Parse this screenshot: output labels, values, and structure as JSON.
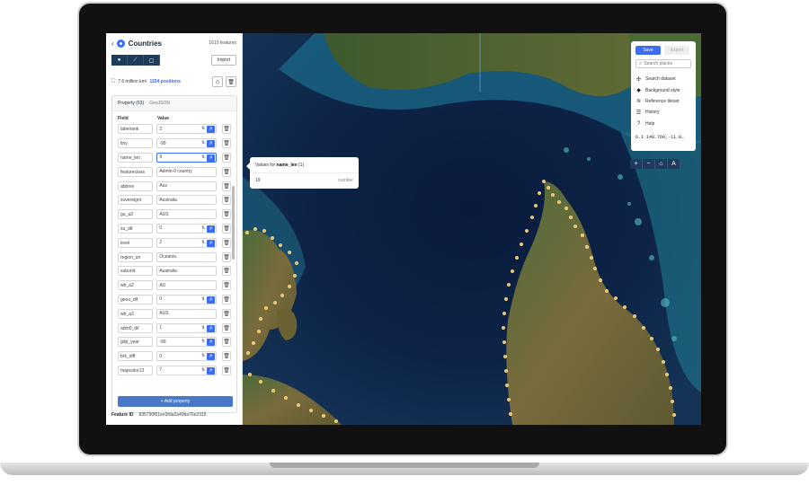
{
  "panel": {
    "title": "Countries",
    "feature_count": "1619 features",
    "import_label": "Import",
    "area": "7.6 million km²",
    "positions": "1154 positions",
    "tabs": [
      "Property (63)",
      "GeoJSON"
    ],
    "columns": {
      "field": "Field",
      "value": "Value"
    },
    "properties": [
      {
        "field": "labelrank",
        "value": "2",
        "numeric": true
      },
      {
        "field": "tiny",
        "value": "-99",
        "numeric": true
      },
      {
        "field": "name_len",
        "value": "9",
        "numeric": true,
        "focused": true
      },
      {
        "field": "featureclass",
        "value": "Admin-0 country",
        "numeric": false
      },
      {
        "field": "abbrev",
        "value": "Aus",
        "numeric": false
      },
      {
        "field": "sovereignt",
        "value": "Australia",
        "numeric": false
      },
      {
        "field": "gu_a3",
        "value": "AUS",
        "numeric": false
      },
      {
        "field": "su_dif",
        "value": "0",
        "numeric": true
      },
      {
        "field": "level",
        "value": "2",
        "numeric": true
      },
      {
        "field": "region_un",
        "value": "Oceania",
        "numeric": false
      },
      {
        "field": "subunit",
        "value": "Australia",
        "numeric": false
      },
      {
        "field": "wb_a2",
        "value": "AU",
        "numeric": false
      },
      {
        "field": "geou_dif",
        "value": "0",
        "numeric": true
      },
      {
        "field": "wb_a3",
        "value": "AUS",
        "numeric": false
      },
      {
        "field": "adm0_dif",
        "value": "1",
        "numeric": true
      },
      {
        "field": "gdp_year",
        "value": "-99",
        "numeric": true
      },
      {
        "field": "brk_diff",
        "value": "0",
        "numeric": true
      },
      {
        "field": "mapcolor13",
        "value": "7",
        "numeric": true
      }
    ],
    "add_property_label": "+ Add property",
    "feature_id_label": "Feature ID",
    "feature_id": "835790f61ee3fda2a40ba76e2915"
  },
  "tooltip": {
    "title_prefix": "Values for",
    "field": "name_len",
    "count": "(1)",
    "value": "19",
    "unit": "number"
  },
  "menu": {
    "save_label": "Save",
    "export_label": "Export",
    "search_placeholder": "Search places",
    "items": [
      {
        "label": "Search dataset",
        "icon": "search-dataset-icon"
      },
      {
        "label": "Background style",
        "icon": "paint-bucket-icon"
      },
      {
        "label": "Reference tileset",
        "icon": "layers-icon"
      },
      {
        "label": "History",
        "icon": "history-icon"
      },
      {
        "label": "Help",
        "icon": "help-icon"
      }
    ],
    "coords": "6.1  140.760,-11.8…"
  },
  "zoom_controls": [
    "+",
    "−",
    "⌂",
    "A"
  ],
  "colors": {
    "accent": "#3a6cf4",
    "toolbar": "#1f3a5a",
    "boundary_dots": "#f2c14e"
  }
}
